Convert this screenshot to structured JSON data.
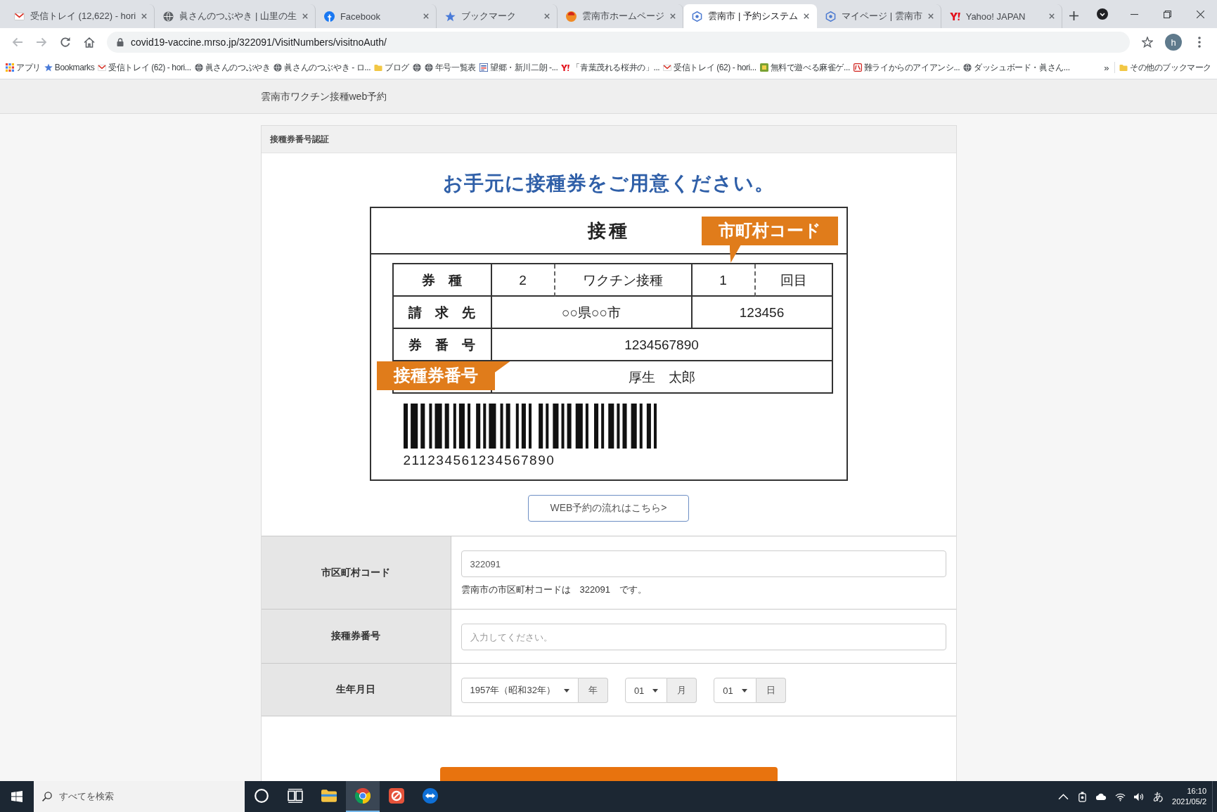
{
  "browser": {
    "tabs": [
      {
        "kind": "mail",
        "title": "受信トレイ (12,622) - hori",
        "selected": false
      },
      {
        "kind": "globe",
        "title": "眞さんのつぶやき | 山里の生",
        "selected": false
      },
      {
        "kind": "social",
        "title": "Facebook",
        "selected": false
      },
      {
        "kind": "star",
        "title": "ブックマーク",
        "selected": false
      },
      {
        "kind": "city",
        "title": "雲南市ホームページ",
        "selected": false
      },
      {
        "kind": "booking",
        "title": "雲南市 | 予約システム",
        "selected": true
      },
      {
        "kind": "booking",
        "title": "マイページ | 雲南市",
        "selected": false
      },
      {
        "kind": "portal",
        "title": "Yahoo! JAPAN",
        "selected": false
      }
    ],
    "address": "covid19-vaccine.mrso.jp/322091/VisitNumbers/visitnoAuth/",
    "avatar": "h",
    "bookmarks": [
      {
        "kind": "apps",
        "label": "アプリ"
      },
      {
        "kind": "star",
        "label": "Bookmarks"
      },
      {
        "kind": "mail",
        "label": "受信トレイ (62) - hori..."
      },
      {
        "kind": "globe",
        "label": "眞さんのつぶやき"
      },
      {
        "kind": "globe",
        "label": "眞さんのつぶやき - ロ..."
      },
      {
        "kind": "folder",
        "label": "ブログ"
      },
      {
        "kind": "globe"
      },
      {
        "kind": "globe",
        "label": "年号一覧表"
      },
      {
        "kind": "site",
        "label": "望郷・新川二朗 -..."
      },
      {
        "kind": "portal",
        "label": "「青葉茂れる桜井の」..."
      },
      {
        "kind": "mail",
        "label": "受信トレイ (62) - hori..."
      },
      {
        "kind": "game",
        "label": "無料で遊べる麻雀ゲ..."
      },
      {
        "kind": "badge",
        "label": "難ライからのアイアンシ..."
      },
      {
        "kind": "globe",
        "label": "ダッシュボード・眞さん..."
      }
    ],
    "more": "»",
    "other_bookmarks": "その他のブックマーク"
  },
  "page": {
    "site_title": "雲南市ワクチン接種web予約",
    "card_title": "接種券番号認証",
    "heading": "お手元に接種券をご用意ください。",
    "ticket": {
      "title": "接種",
      "type_label": "券　種",
      "type_number": "2",
      "type_name": "ワクチン接種",
      "dose": "1",
      "dose_unit": "回目",
      "payer_label": "請　求　先",
      "payer": "○○県○○市",
      "code": "123456",
      "number_label": "券　番　号",
      "number": "1234567890",
      "name": "厚生　太郎",
      "barcode_digits": "211234561234567890",
      "code_callout": "市町村コード",
      "number_callout": "接種券番号"
    },
    "flow_link": "WEB予約の流れはこちら>",
    "form": [
      {
        "kind": "input",
        "label": "市区町村コード",
        "value": "322091",
        "help": "雲南市の市区町村コードは　322091　です。"
      },
      {
        "kind": "input",
        "label": "接種券番号",
        "placeholder": "入力してください。"
      },
      {
        "kind": "date",
        "label": "生年月日",
        "selects": [
          {
            "value": "1957年（昭和32年）",
            "unit": "年"
          },
          {
            "value": "01",
            "unit": "月"
          },
          {
            "value": "01",
            "unit": "日"
          }
        ]
      }
    ]
  },
  "taskbar": {
    "search_placeholder": "すべてを検索",
    "apps": [
      {
        "kind": "ring",
        "selected": false
      },
      {
        "kind": "task-view",
        "selected": false
      },
      {
        "kind": "explorer",
        "selected": false
      },
      {
        "kind": "browser",
        "selected": true
      },
      {
        "kind": "red-app",
        "selected": false
      },
      {
        "kind": "remote",
        "selected": false
      }
    ],
    "ime": "あ",
    "time": "16:10",
    "date": "2021/05/2"
  }
}
